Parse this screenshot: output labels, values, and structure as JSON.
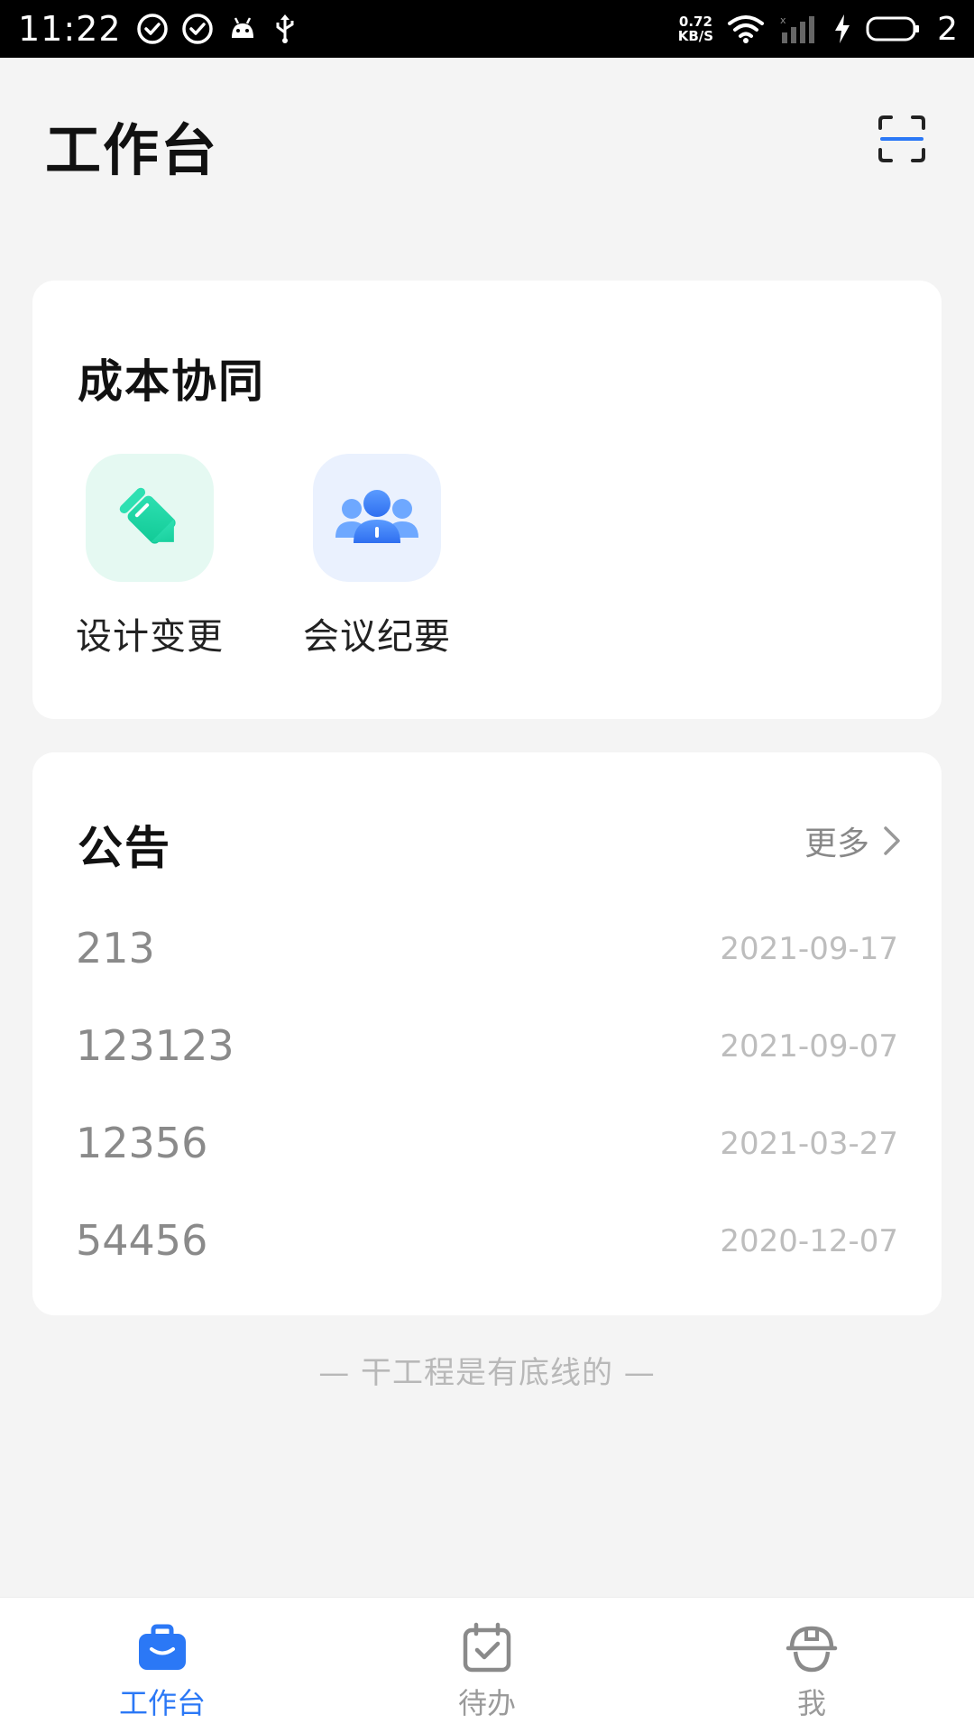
{
  "status_bar": {
    "time": "11:22",
    "netspeed_value": "0.72",
    "netspeed_unit": "KB/S",
    "battery_level": "2"
  },
  "header": {
    "title": "工作台",
    "scan_icon": "scan-icon"
  },
  "cost_section": {
    "title": "成本协同",
    "items": [
      {
        "label": "设计变更",
        "icon": "pencil-icon",
        "color": "#17d1a0"
      },
      {
        "label": "会议纪要",
        "icon": "people-icon",
        "color": "#3a7cf5"
      }
    ]
  },
  "notice_section": {
    "title": "公告",
    "more_label": "更多",
    "items": [
      {
        "title": "213",
        "date": "2021-09-17"
      },
      {
        "title": "123123",
        "date": "2021-09-07"
      },
      {
        "title": "12356",
        "date": "2021-03-27"
      },
      {
        "title": "54456",
        "date": "2020-12-07"
      }
    ]
  },
  "slogan": "— 干工程是有底线的 —",
  "bottom_nav": {
    "items": [
      {
        "label": "工作台",
        "icon": "briefcase-icon",
        "active": true
      },
      {
        "label": "待办",
        "icon": "calendar-check-icon",
        "active": false
      },
      {
        "label": "我",
        "icon": "helmet-icon",
        "active": false
      }
    ]
  },
  "colors": {
    "accent": "#2b78f6",
    "background": "#f4f4f4",
    "card": "#ffffff"
  }
}
